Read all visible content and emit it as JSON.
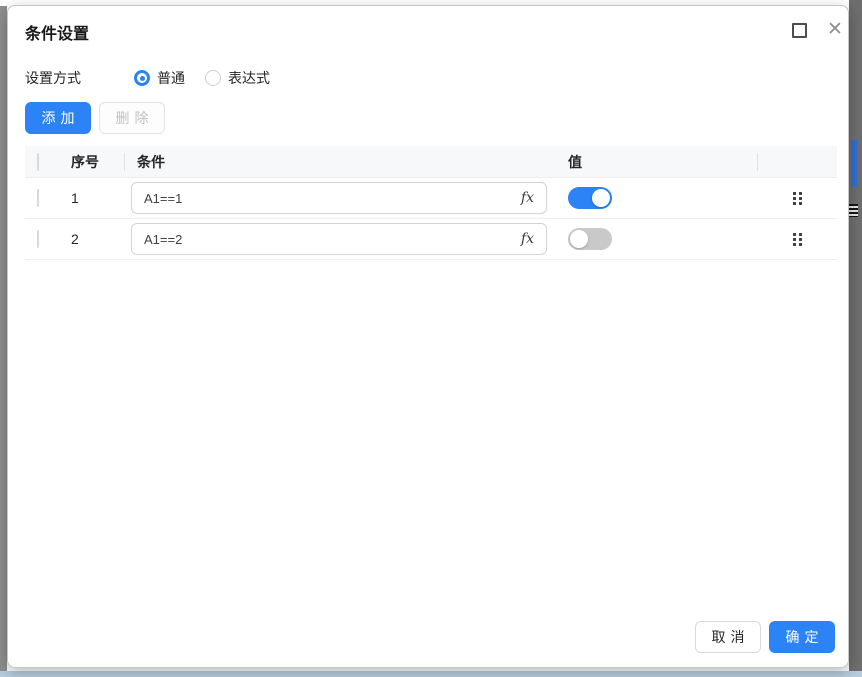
{
  "dialog": {
    "title": "条件设置"
  },
  "window_controls": {
    "maximize_icon": "square-outline",
    "close_glyph": "✕"
  },
  "settings": {
    "label": "设置方式",
    "options": [
      {
        "label": "普通",
        "selected": true
      },
      {
        "label": "表达式",
        "selected": false
      }
    ]
  },
  "toolbar": {
    "add_label": "添加",
    "delete_label": "删除",
    "delete_disabled": true
  },
  "table": {
    "headers": {
      "index": "序号",
      "condition": "条件",
      "value": "值"
    },
    "fx_glyph": "fx",
    "rows": [
      {
        "index": "1",
        "condition": "A1==1",
        "value_on": true,
        "checked": false
      },
      {
        "index": "2",
        "condition": "A1==2",
        "value_on": false,
        "checked": false
      }
    ]
  },
  "footer": {
    "cancel_label": "取消",
    "confirm_label": "确定"
  },
  "colors": {
    "accent": "#2b83f6",
    "toggle_off": "#c9c9c9",
    "delete_disabled_text": "#c2c2c2"
  }
}
